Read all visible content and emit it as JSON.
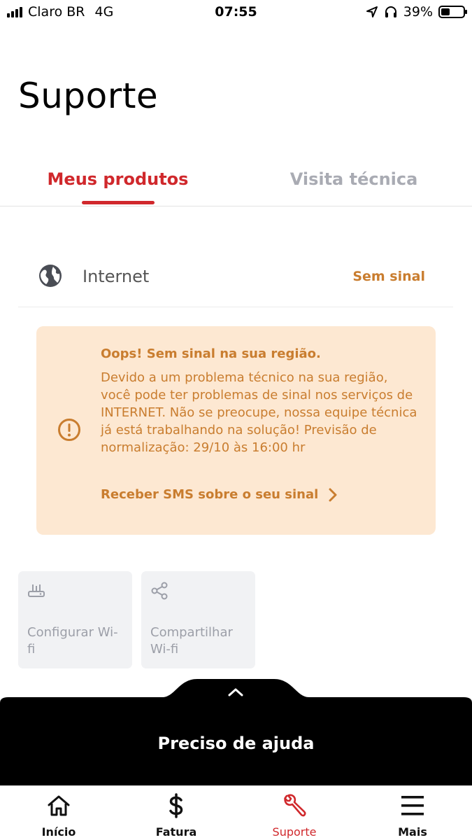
{
  "status_bar": {
    "carrier": "Claro BR",
    "network": "4G",
    "time": "07:55",
    "battery_percent": "39%",
    "battery_level": 0.39,
    "icons": [
      "signal-icon",
      "location-arrow-icon",
      "headphones-icon",
      "battery-icon"
    ]
  },
  "page": {
    "title": "Suporte"
  },
  "tabs": [
    {
      "label": "Meus produtos",
      "active": true
    },
    {
      "label": "Visita técnica",
      "active": false
    }
  ],
  "product": {
    "icon": "globe-icon",
    "name": "Internet",
    "status": "Sem sinal"
  },
  "alert": {
    "icon": "exclamation-circle-icon",
    "title": "Oops! Sem sinal na sua região.",
    "message": "Devido a um problema técnico na sua região, você pode ter problemas de sinal nos serviços de INTERNET. Não se preocupe, nossa equipe técnica já está trabalhando na solução! Previsão de normalização: 29/10 às 16:00 hr",
    "link_label": "Receber SMS sobre o seu sinal"
  },
  "actions": [
    {
      "icon": "router-icon",
      "label": "Configurar Wi-fi"
    },
    {
      "icon": "share-icon",
      "label": "Compartilhar Wi-fi"
    }
  ],
  "help": {
    "label": "Preciso de ajuda"
  },
  "bottom_nav": [
    {
      "icon": "home-icon",
      "label": "Início",
      "active": false
    },
    {
      "icon": "dollar-icon",
      "label": "Fatura",
      "active": false
    },
    {
      "icon": "wrench-icon",
      "label": "Suporte",
      "active": true
    },
    {
      "icon": "menu-icon",
      "label": "Mais",
      "active": false
    }
  ],
  "colors": {
    "brand_red": "#d0282c",
    "warning_orange": "#c97d2f",
    "alert_background": "#fde8d2",
    "inactive_gray": "#a9abb3"
  }
}
